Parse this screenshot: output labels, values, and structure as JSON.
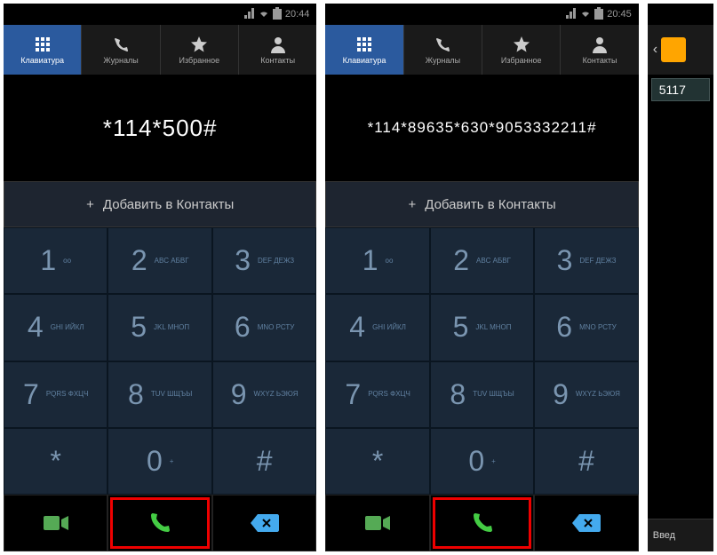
{
  "status": {
    "time": "20:44",
    "time2": "20:45"
  },
  "tabs": {
    "keypad": "Клавиатура",
    "logs": "Журналы",
    "favorites": "Избранное",
    "contacts": "Контакты"
  },
  "phone1": {
    "display": "*114*500#"
  },
  "phone2": {
    "display": "*114*89635*630*9053332211#"
  },
  "add_contact": "Добавить в Контакты",
  "keys": {
    "k1": {
      "digit": "1",
      "sub": "оо"
    },
    "k2": {
      "digit": "2",
      "sub": "ABC\nАБВГ"
    },
    "k3": {
      "digit": "3",
      "sub": "DEF\nДЕЖЗ"
    },
    "k4": {
      "digit": "4",
      "sub": "GHI\nИЙКЛ"
    },
    "k5": {
      "digit": "5",
      "sub": "JKL\nМНОП"
    },
    "k6": {
      "digit": "6",
      "sub": "MNO\nРСТУ"
    },
    "k7": {
      "digit": "7",
      "sub": "PQRS\nФХЦЧ"
    },
    "k8": {
      "digit": "8",
      "sub": "TUV\nШЩЪЫ"
    },
    "k9": {
      "digit": "9",
      "sub": "WXYZ\nЬЭЮЯ"
    },
    "kstar": {
      "digit": "*",
      "sub": ""
    },
    "k0": {
      "digit": "0",
      "sub": "+"
    },
    "khash": {
      "digit": "#",
      "sub": ""
    }
  },
  "partial": {
    "num": "5117",
    "bottom": "Введ"
  }
}
